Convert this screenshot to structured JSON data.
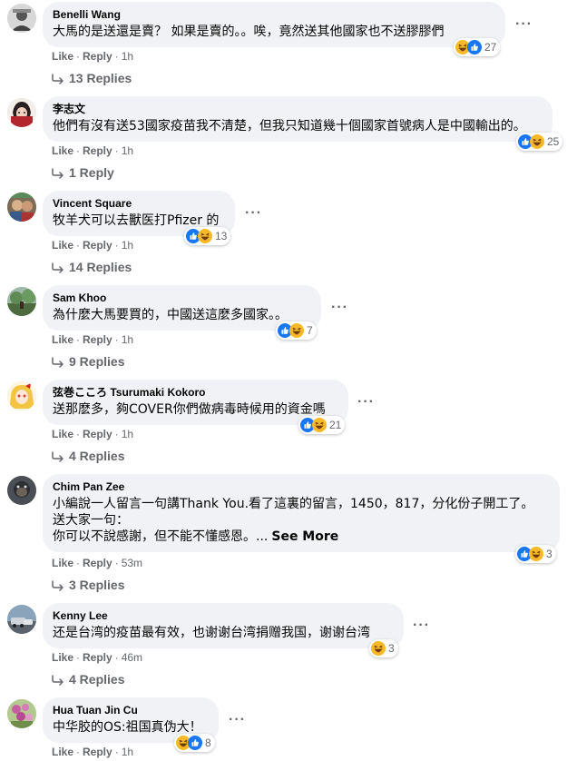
{
  "comments": [
    {
      "author": "Benelli Wang",
      "lines": [
        "大馬的是送還是賣？ 如果是賣的。。唉，竟然送其他國家也不送膠膠們"
      ],
      "reactions": "27",
      "time": "1h",
      "replies": "13 Replies"
    },
    {
      "author": "李志文",
      "lines": [
        "他們有沒有送53國家疫苗我不清楚，但我只知道幾十個國家首號病人是中國輸出的。"
      ],
      "reactions": "25",
      "time": "1h",
      "replies": "1 Reply"
    },
    {
      "author": "Vincent Square",
      "lines": [
        "牧羊犬可以去獸医打Pfizer 的"
      ],
      "reactions": "13",
      "time": "1h",
      "replies": "14 Replies"
    },
    {
      "author": "Sam Khoo",
      "lines": [
        "為什麼大馬要買的，中國送這麼多國家。。"
      ],
      "reactions": "7",
      "time": "1h",
      "replies": "9 Replies"
    },
    {
      "author": "弦巻こころ Tsurumaki Kokoro",
      "lines": [
        "送那麽多，夠COVER你們做病毒時候用的資金嗎"
      ],
      "reactions": "21",
      "time": "1h",
      "replies": "4 Replies"
    },
    {
      "author": "Chim Pan Zee",
      "lines": [
        "小編說一人留言一句講Thank You.看了這裏的留言，1450，817，分化份子開工了。",
        "送大家一句：",
        "你可以不說感謝，但不能不懂感恩。..."
      ],
      "see_more": "See More",
      "reactions": "3",
      "time": "53m",
      "replies": "3 Replies"
    },
    {
      "author": "Kenny Lee",
      "lines": [
        "还是台湾的疫苗最有效，也谢谢台湾捐赠我国，谢谢台湾"
      ],
      "reactions": "3",
      "time": "46m",
      "replies": "4 Replies"
    },
    {
      "author": "Hua Tuan Jin Cu",
      "lines": [
        "中华胶的OS:祖国真伪大！"
      ],
      "reactions": "8",
      "time": "1h",
      "replies": ""
    }
  ],
  "labels": {
    "like": "Like",
    "reply": "Reply",
    "dot": "·",
    "more": "···"
  },
  "colors": {
    "bubble": "#f0f2f5",
    "secondary_text": "#65676b",
    "like_blue": "#1877f2",
    "haha_yellow": "#f7b928"
  }
}
